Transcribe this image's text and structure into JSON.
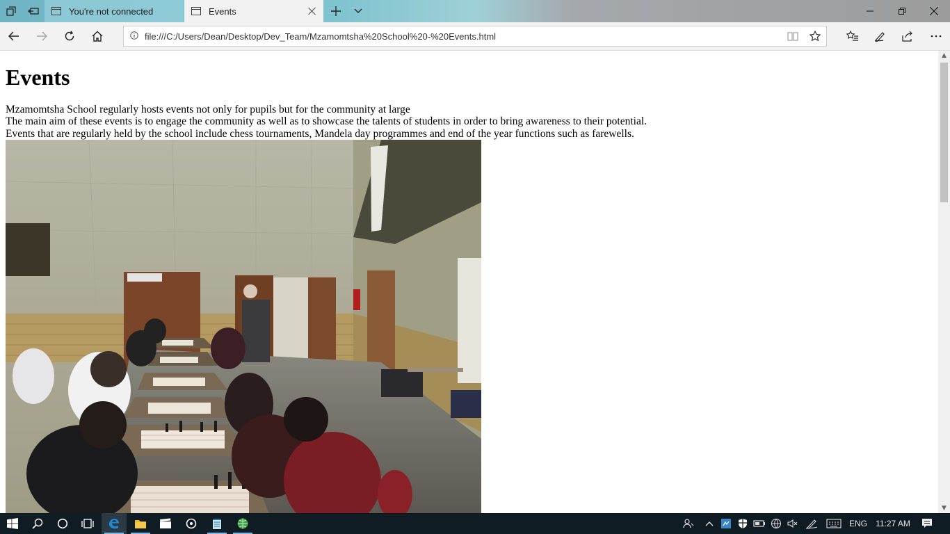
{
  "browser": {
    "tabs": [
      {
        "label": "You're not connected",
        "active": false
      },
      {
        "label": "Events",
        "active": true
      }
    ],
    "address": "file:///C:/Users/Dean/Desktop/Dev_Team/Mzamomtsha%20School%20-%20Events.html"
  },
  "page": {
    "title": "Events",
    "paragraphs": [
      "Mzamomtsha School regularly hosts events not only for pupils but for the community at large",
      "The main aim of these events is to engage the community as well as to showcase the talents of students in order to bring awareness to their potential.",
      "Events that are regularly held by the school include chess tournaments, Mandela day programmes and end of the year functions such as farewells."
    ]
  },
  "taskbar": {
    "language": "ENG",
    "time": "11:27 AM"
  },
  "colors": {
    "titlebar_left": "#6fb4c4",
    "titlebar_right": "#9c9c9c",
    "toolbar_bg": "#f2f2f2",
    "taskbar_bg": "#101c24",
    "edge_blue": "#1f88d8"
  }
}
